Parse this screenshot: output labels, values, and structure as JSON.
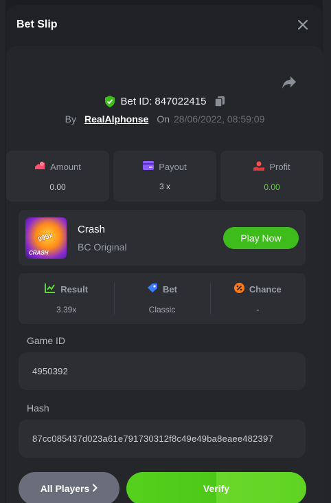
{
  "modal": {
    "title": "Bet Slip"
  },
  "bet": {
    "id_label": "Bet ID:",
    "id_value": "847022415",
    "by_label": "By",
    "username": "RealAlphonse",
    "on_label": "On",
    "datetime": "28/06/2022, 08:59:09"
  },
  "stats": [
    {
      "label": "Amount",
      "value": "0.00",
      "icon": "amount-icon",
      "color": "#ff4d6d"
    },
    {
      "label": "Payout",
      "value": "3 x",
      "icon": "payout-card-icon",
      "color": "#8c5bff"
    },
    {
      "label": "Profit",
      "value": "0.00",
      "icon": "profit-icon",
      "color": "#ff4d4d"
    }
  ],
  "game": {
    "name": "Crash",
    "provider": "BC Original",
    "thumb_multiplier": "999x",
    "thumb_label": "CRASH",
    "play_label": "Play Now"
  },
  "result": [
    {
      "label": "Result",
      "value": "3.39x",
      "icon": "result-chart-icon",
      "color": "#5fd43c"
    },
    {
      "label": "Bet",
      "value": "Classic",
      "icon": "bet-tag-icon",
      "color": "#3d7bff"
    },
    {
      "label": "Chance",
      "value": "-",
      "icon": "chance-percent-icon",
      "color": "#ff7a1a"
    }
  ],
  "fields": {
    "game_id_label": "Game ID",
    "game_id_value": "4950392",
    "hash_label": "Hash",
    "hash_value": "87cc085437d023a61e791730312f8c49e49ba8eaee482397"
  },
  "buttons": {
    "all_players": "All Players",
    "verify": "Verify"
  },
  "colors": {
    "accent_green": "#3ebc1c",
    "background": "#1f2124",
    "card": "#2c2e33"
  }
}
